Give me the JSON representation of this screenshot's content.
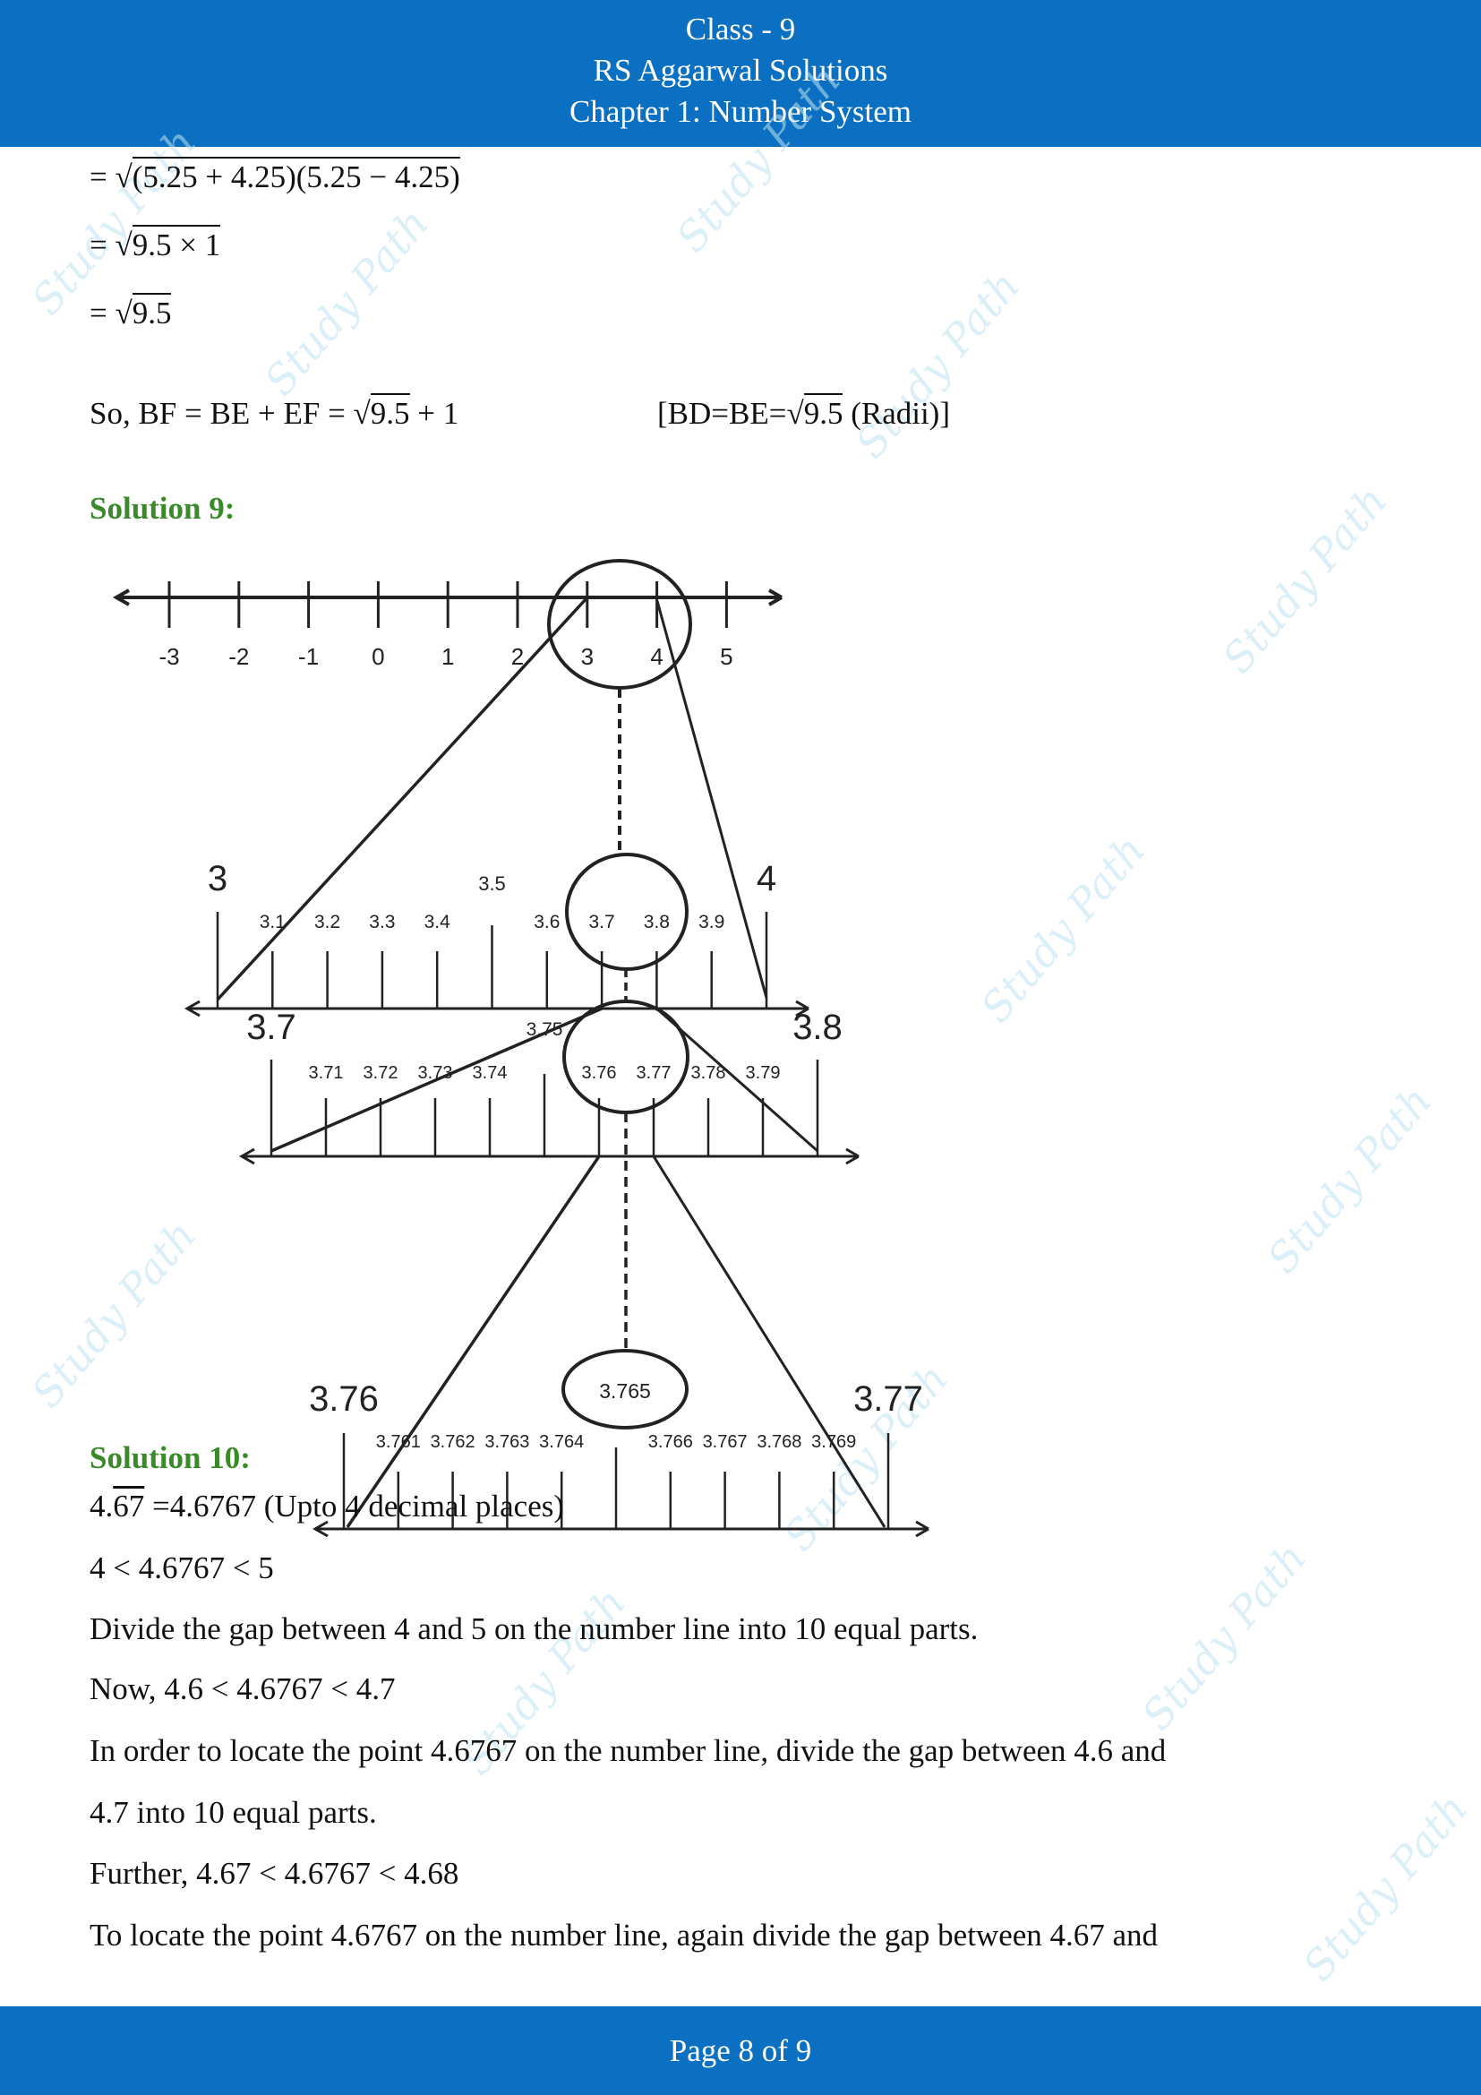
{
  "header": {
    "line1": "Class - 9",
    "line2": "RS Aggarwal Solutions",
    "line3": "Chapter 1: Number System"
  },
  "watermark": "Study Path",
  "work": {
    "eq1_prefix": "= √",
    "eq1_radicand": "(5.25 + 4.25)(5.25 − 4.25)",
    "eq2_prefix": "= √",
    "eq2_radicand": "9.5 × 1",
    "eq3_prefix": "= √",
    "eq3_radicand": "9.5",
    "so_prefix": "So,  BF = BE + EF = √",
    "so_radicand": "9.5",
    "so_suffix": " + 1",
    "note_prefix": "[BD=BE=√",
    "note_radicand": "9.5",
    "note_suffix": " (Radii)]"
  },
  "solution9": {
    "heading": "Solution 9:",
    "line1": {
      "labels": [
        "-3",
        "-2",
        "-1",
        "0",
        "1",
        "2",
        "3",
        "4",
        "5"
      ]
    },
    "line2": {
      "start": "3",
      "end": "4",
      "mid": "3.5",
      "labels": [
        "3.1",
        "3.2",
        "3.3",
        "3.4",
        "3.6",
        "3.7",
        "3.8",
        "3.9"
      ]
    },
    "line3": {
      "start": "3.7",
      "end": "3.8",
      "mid": "3.75",
      "labels": [
        "3.71",
        "3.72",
        "3.73",
        "3.74",
        "3.76",
        "3.77",
        "3.78",
        "3.79"
      ]
    },
    "line4": {
      "start": "3.76",
      "end": "3.77",
      "mid": "3.765",
      "labels": [
        "3.761",
        "3.762",
        "3.763",
        "3.764",
        "3.766",
        "3.767",
        "3.768",
        "3.769"
      ]
    }
  },
  "solution10": {
    "heading": "Solution 10:",
    "l1_a": "4.",
    "l1_rep": "67",
    "l1_b": " =4.6767  (Upto 4 decimal places)",
    "l2": "4 < 4.6767 < 5",
    "l3": "Divide the gap between 4 and 5 on the number line into 10 equal parts.",
    "l4": "Now, 4.6 < 4.6767 < 4.7",
    "l5": "In order to locate the point 4.6767 on the number line, divide the gap between 4.6 and",
    "l6": "4.7 into 10 equal parts.",
    "l7": "Further, 4.67 < 4.6767 < 4.68",
    "l8": "To locate the point 4.6767 on the number line, again divide the gap between 4.67 and"
  },
  "footer": {
    "page_label": "Page 8 of 9"
  },
  "colors": {
    "header_bg": "#0b70c1",
    "heading_green": "#3a8a2a"
  }
}
